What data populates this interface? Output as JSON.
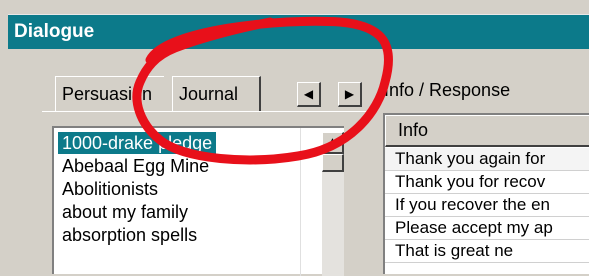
{
  "window": {
    "title": "Dialogue"
  },
  "tabs": [
    {
      "label": "Persuasion"
    },
    {
      "label": "Journal"
    }
  ],
  "tab_nav": {
    "prev": "◀",
    "next": "▶"
  },
  "info_response_label": "Info / Response",
  "topics": [
    {
      "label": "1000-drake pledge",
      "selected": true
    },
    {
      "label": "Abebaal Egg Mine"
    },
    {
      "label": "Abolitionists"
    },
    {
      "label": "about my family"
    },
    {
      "label": "absorption spells"
    }
  ],
  "scroll": {
    "up": "▲"
  },
  "responses": {
    "header": "Info",
    "rows": [
      "Thank you again for",
      "Thank you for recov",
      "If you recover the en",
      "Please accept my ap",
      "That is great ne"
    ]
  },
  "annotation_color": "#e8101a"
}
